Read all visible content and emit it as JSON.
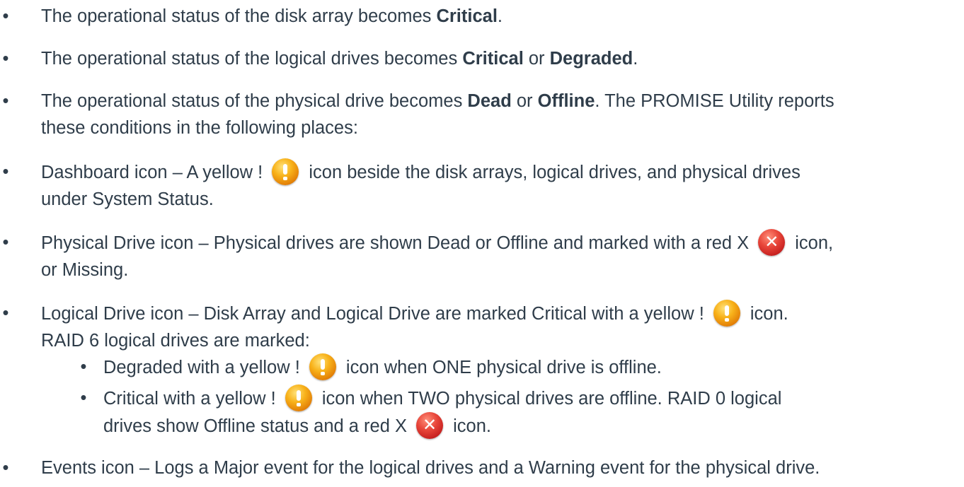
{
  "bullet": "•",
  "items": [
    {
      "a": "The operational status of the disk array becomes ",
      "b": "Critical",
      "c": "."
    },
    {
      "a": "The operational status of the logical drives becomes ",
      "b": "Critical",
      "c": " or ",
      "d": "Degraded",
      "e": "."
    },
    {
      "a": "The operational status of the physical drive becomes ",
      "b": "Dead",
      "c": " or ",
      "d": "Offline",
      "e": ". The PROMISE Utility reports",
      "line2": "these conditions in the following places:"
    },
    {
      "a": "Dashboard icon – A yellow ! ",
      "b": "icon beside the disk arrays, logical drives, and physical drives",
      "line2": "under System Status."
    },
    {
      "a": "Physical Drive icon – Physical drives are shown Dead or Offline and marked with a red X ",
      "b": "icon,",
      "line2": "or Missing."
    },
    {
      "a": "Logical Drive icon – Disk Array and Logical Drive are marked Critical with a yellow ! ",
      "b": "icon.",
      "line2": "RAID 6 logical drives are marked:"
    },
    {
      "a": "Degraded with a yellow ! ",
      "b": "icon when ONE physical drive is offline."
    },
    {
      "a": "Critical with a yellow ! ",
      "b": "icon when TWO physical drives are offline. RAID 0 logical",
      "line2a": "drives show Offline status and a red X ",
      "line2b": "icon."
    },
    {
      "a": "Events icon – Logs a Major event for the logical drives and a Warning event for the physical drive."
    }
  ],
  "icons": {
    "warning": "warning-icon",
    "error": "error-icon",
    "error_glyph": "✕"
  },
  "colors": {
    "text": "#2f3d4a",
    "warning": "#f8b21a",
    "error": "#c41e1e"
  }
}
